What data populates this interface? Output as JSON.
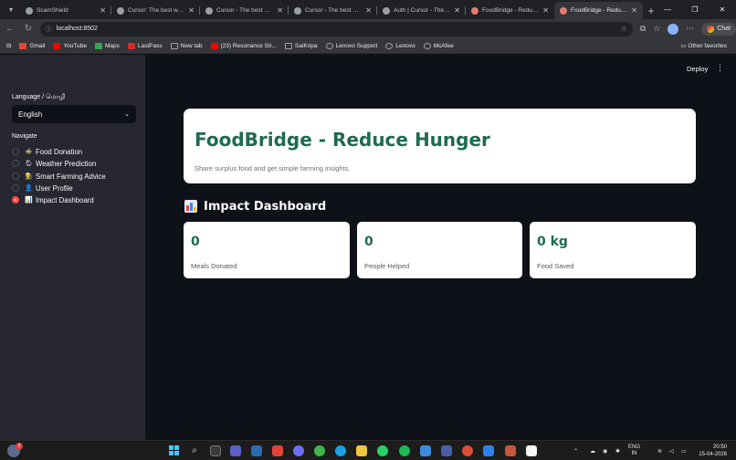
{
  "browser": {
    "tabs": [
      {
        "title": "ScamShield",
        "color": "#8ab4f8"
      },
      {
        "title": "Cursor: The best way to code",
        "color": "#9aa0a6"
      },
      {
        "title": "Cursor - The best way to code",
        "color": "#9aa0a6"
      },
      {
        "title": "Cursor - The best way to code",
        "color": "#9aa0a6"
      },
      {
        "title": "Auth | Cursor - The best way",
        "color": "#9aa0a6"
      },
      {
        "title": "FoodBridge - Reduce Hunger",
        "color": "#e37d6f"
      },
      {
        "title": "FoodBridge - Reduce Hunger",
        "color": "#e37d6f"
      }
    ],
    "address": "localhost:8502",
    "chat_label": "Chat",
    "bookmarks": [
      {
        "label": "Gmail",
        "color": "#ea4335"
      },
      {
        "label": "YouTube",
        "color": "#ff0000"
      },
      {
        "label": "Maps",
        "color": "#34a853"
      },
      {
        "label": "LastPass",
        "color": "#d32d27"
      },
      {
        "label": "New tab",
        "color": "#9aa0a6"
      },
      {
        "label": "(23) Resonance Str...",
        "color": "#ff0000"
      },
      {
        "label": "SaiKripa",
        "color": "#9aa0a6"
      },
      {
        "label": "Lenovo Support",
        "color": "#9aa0a6"
      },
      {
        "label": "Lenovo",
        "color": "#9aa0a6"
      },
      {
        "label": "McAfee",
        "color": "#9aa0a6"
      }
    ],
    "other_bookmarks": "Other favorites"
  },
  "sidebar": {
    "language_label": "Language / மொழி",
    "language_value": "English",
    "navigate_label": "Navigate",
    "nav_items": [
      {
        "label": "Food Donation",
        "icon": "🍲",
        "selected": false
      },
      {
        "label": "Weather Prediction",
        "icon": "🌦",
        "selected": false
      },
      {
        "label": "Smart Farming Advice",
        "icon": "👨‍🌾",
        "selected": false
      },
      {
        "label": "User Profile",
        "icon": "👤",
        "selected": false
      },
      {
        "label": "Impact Dashboard",
        "icon": "📊",
        "selected": true
      }
    ]
  },
  "header": {
    "deploy_label": "Deploy"
  },
  "main": {
    "title": "FoodBridge - Reduce Hunger",
    "subtitle": "Share surplus food and get simple farming insights.",
    "dashboard_title": "Impact Dashboard",
    "metrics": [
      {
        "value": "0",
        "label": "Meals Donated"
      },
      {
        "value": "0",
        "label": "People Helped"
      },
      {
        "value": "0 kg",
        "label": "Food Saved"
      }
    ]
  },
  "taskbar": {
    "weather_badge": "2",
    "lang_line1": "ENG",
    "lang_line2": "IN",
    "time": "20:50",
    "date": "15-04-2026"
  },
  "colors": {
    "accent_green": "#1f6b4f",
    "radio_active": "#ff4b4b",
    "sidebar_bg": "#262730",
    "main_bg": "#0e1117"
  }
}
